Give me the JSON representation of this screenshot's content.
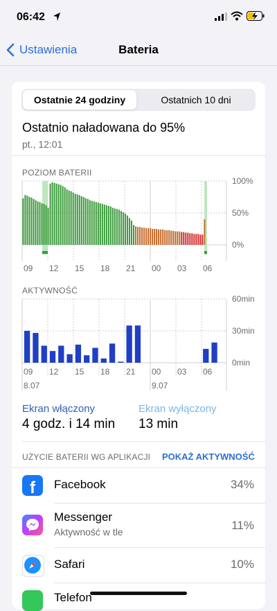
{
  "status_bar": {
    "time": "06:42"
  },
  "nav": {
    "back_label": "Ustawienia",
    "title": "Bateria"
  },
  "segments": [
    "Ostatnie 24 godziny",
    "Ostatnich 10 dni"
  ],
  "last_charged": {
    "title": "Ostatnio naładowana do 95%",
    "time": "pt., 12:01"
  },
  "battery_chart": {
    "label": "POZIOM BATERII",
    "y_labels": [
      "100%",
      "50%",
      "0%"
    ],
    "x_labels": [
      "09",
      "12",
      "15",
      "18",
      "21",
      "00",
      "03",
      "06"
    ]
  },
  "activity_chart": {
    "label": "AKTYWNOŚĆ",
    "y_labels": [
      "60min",
      "30min",
      "0min"
    ],
    "x_labels": [
      "09",
      "12",
      "15",
      "18",
      "21",
      "00",
      "03",
      "06"
    ],
    "date_labels": [
      "8.07",
      "9.07"
    ]
  },
  "chart_data": [
    {
      "type": "bar",
      "title": "POZIOM BATERII",
      "ylim": [
        0,
        100
      ],
      "y_unit": "%",
      "values": [
        73,
        78,
        77,
        75,
        74,
        72,
        70,
        68,
        67,
        65,
        64,
        62,
        58,
        96,
        98,
        97,
        96,
        95,
        94,
        92,
        90,
        87,
        85,
        84,
        82,
        80,
        79,
        78,
        76,
        75,
        73,
        72,
        70,
        69,
        68,
        67,
        66,
        65,
        64,
        63,
        62,
        61,
        60,
        58,
        57,
        56,
        55,
        53,
        51,
        49,
        46,
        42,
        38,
        31,
        29,
        28,
        28,
        27,
        27,
        26,
        26,
        26,
        25,
        25,
        25,
        24,
        24,
        24,
        23,
        23,
        23,
        22,
        22,
        21,
        21,
        21,
        20,
        20,
        19,
        19,
        18,
        18,
        17,
        17,
        17,
        16,
        16,
        40
      ]
    },
    {
      "type": "bar",
      "title": "AKTYWNOŚĆ",
      "ylim": [
        0,
        60
      ],
      "y_unit": "min",
      "categories": [
        "08:00",
        "09:00",
        "10:00",
        "11:00",
        "12:00",
        "13:00",
        "14:00",
        "15:00",
        "16:00",
        "17:00",
        "18:00",
        "19:00",
        "20:00",
        "21:00",
        "22:00",
        "23:00",
        "00:00",
        "01:00",
        "02:00",
        "03:00",
        "04:00",
        "05:00",
        "06:00"
      ],
      "values": [
        30,
        28,
        16,
        11,
        16,
        8,
        17,
        7,
        14,
        4,
        18,
        1,
        35,
        35,
        0,
        0,
        0,
        0,
        0,
        0,
        0,
        13,
        19
      ]
    }
  ],
  "screen": {
    "on_label": "Ekran włączony",
    "on_value": "4 godz. i 14 min",
    "off_label": "Ekran wyłączony",
    "off_value": "13 min"
  },
  "usage": {
    "label": "UŻYCIE BATERII WG APLIKACJI",
    "action": "POKAŻ AKTYWNOŚĆ",
    "apps": [
      {
        "name": "Facebook",
        "sub": "",
        "pct": "34%",
        "icon": "facebook-icon",
        "color": "#1877f2"
      },
      {
        "name": "Messenger",
        "sub": "Aktywność w tle",
        "pct": "11%",
        "icon": "messenger-icon",
        "color": "#a83ff0"
      },
      {
        "name": "Safari",
        "sub": "",
        "pct": "10%",
        "icon": "safari-icon",
        "color": "#1e90ff"
      },
      {
        "name": "Telefon",
        "sub": "",
        "pct": "",
        "icon": "phone-icon",
        "color": "#34c759"
      }
    ]
  },
  "colors": {
    "accent": "#2b6fd6",
    "battery_green": "#3a9a3a",
    "battery_orange": "#c46a2a",
    "battery_red": "#d12f32",
    "activity_blue": "#1f3fc4",
    "charging_highlight": "#bfe6bf"
  }
}
